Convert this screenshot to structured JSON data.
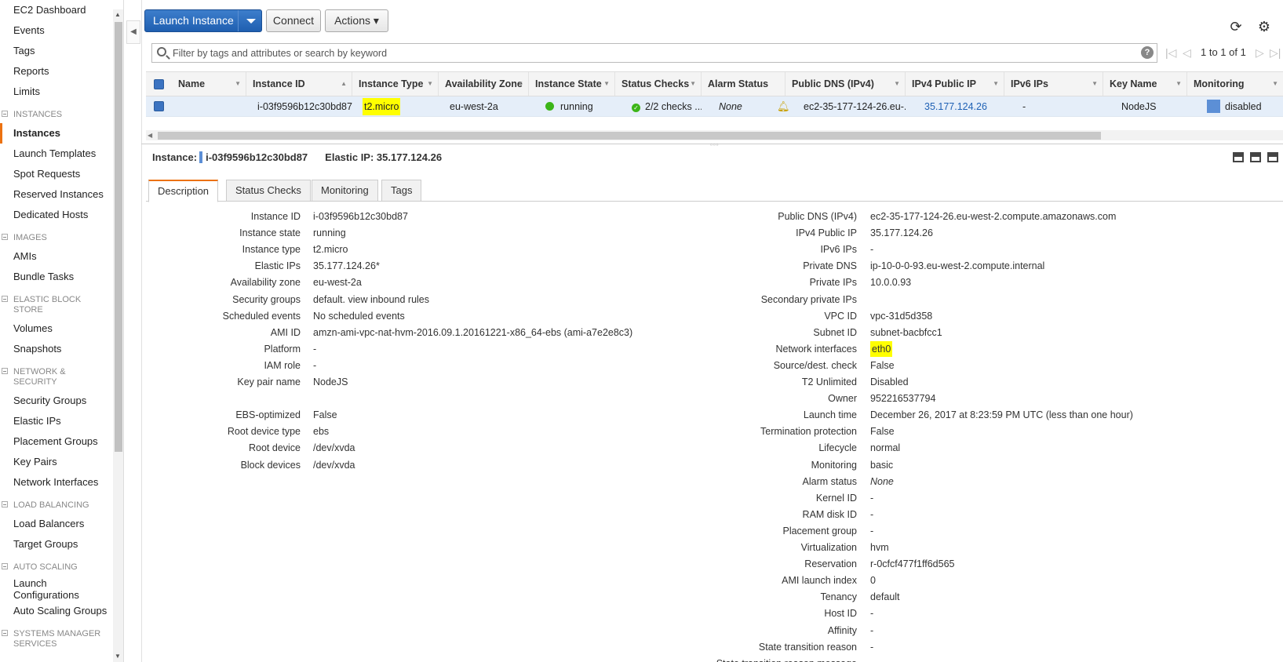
{
  "sidebar": {
    "top_items": [
      "EC2 Dashboard",
      "Events",
      "Tags",
      "Reports",
      "Limits"
    ],
    "sections": [
      {
        "title": "INSTANCES",
        "items": [
          "Instances",
          "Launch Templates",
          "Spot Requests",
          "Reserved Instances",
          "Dedicated Hosts"
        ]
      },
      {
        "title": "IMAGES",
        "items": [
          "AMIs",
          "Bundle Tasks"
        ]
      },
      {
        "title": "ELASTIC BLOCK STORE",
        "items": [
          "Volumes",
          "Snapshots"
        ]
      },
      {
        "title": "NETWORK & SECURITY",
        "items": [
          "Security Groups",
          "Elastic IPs",
          "Placement Groups",
          "Key Pairs",
          "Network Interfaces"
        ]
      },
      {
        "title": "LOAD BALANCING",
        "items": [
          "Load Balancers",
          "Target Groups"
        ]
      },
      {
        "title": "AUTO SCALING",
        "items": [
          "Launch Configurations",
          "Auto Scaling Groups"
        ]
      },
      {
        "title": "SYSTEMS MANAGER SERVICES",
        "items": []
      }
    ],
    "active_item": "Instances"
  },
  "toolbar": {
    "launch_label": "Launch Instance",
    "connect_label": "Connect",
    "actions_label": "Actions ▾",
    "refresh_icon": "refresh-icon",
    "settings_icon": "gear-icon"
  },
  "search": {
    "placeholder": "Filter by tags and attributes or search by keyword",
    "help": "?",
    "pager_text": "1 to 1 of 1"
  },
  "table": {
    "columns": [
      "Name",
      "Instance ID",
      "Instance Type",
      "Availability Zone",
      "Instance State",
      "Status Checks",
      "Alarm Status",
      "Public DNS (IPv4)",
      "IPv4 Public IP",
      "IPv6 IPs",
      "Key Name",
      "Monitoring"
    ],
    "row": {
      "name": "",
      "instance_id": "i-03f9596b12c30bd87",
      "instance_type": "t2.micro",
      "availability_zone": "eu-west-2a",
      "instance_state": "running",
      "status_checks": "2/2 checks ...",
      "alarm_status": "None",
      "public_dns": "ec2-35-177-124-26.eu-...",
      "ipv4_public_ip": "35.177.124.26",
      "ipv6_ips": "-",
      "key_name": "NodeJS",
      "monitoring": "disabled"
    }
  },
  "details": {
    "instance_label": "Instance:",
    "instance_id": "i-03f9596b12c30bd87",
    "elastic_label": "Elastic IP: 35.177.124.26",
    "tabs": [
      "Description",
      "Status Checks",
      "Monitoring",
      "Tags"
    ],
    "left": [
      {
        "key": "Instance ID",
        "value": "i-03f9596b12c30bd87"
      },
      {
        "key": "Instance state",
        "value": "running"
      },
      {
        "key": "Instance type",
        "value": "t2.micro"
      },
      {
        "key": "Elastic IPs",
        "value": "35.177.124.26*",
        "link": true
      },
      {
        "key": "Availability zone",
        "value": "eu-west-2a"
      },
      {
        "key": "Security groups",
        "value": "default. view inbound rules",
        "link": true
      },
      {
        "key": "Scheduled events",
        "value": "No scheduled events",
        "link": true
      },
      {
        "key": "AMI ID",
        "value": "amzn-ami-vpc-nat-hvm-2016.09.1.20161221-x86_64-ebs (ami-a7e2e8c3)",
        "link": true
      },
      {
        "key": "Platform",
        "value": "-"
      },
      {
        "key": "IAM role",
        "value": "-"
      },
      {
        "key": "Key pair name",
        "value": "NodeJS"
      },
      {
        "key": "",
        "value": ""
      },
      {
        "key": "EBS-optimized",
        "value": "False"
      },
      {
        "key": "Root device type",
        "value": "ebs"
      },
      {
        "key": "Root device",
        "value": "/dev/xvda",
        "link": true
      },
      {
        "key": "Block devices",
        "value": "/dev/xvda",
        "link": true
      }
    ],
    "right": [
      {
        "key": "Public DNS (IPv4)",
        "value": "ec2-35-177-124-26.eu-west-2.compute.amazonaws.com"
      },
      {
        "key": "IPv4 Public IP",
        "value": "35.177.124.26",
        "link": true
      },
      {
        "key": "IPv6 IPs",
        "value": "-"
      },
      {
        "key": "Private DNS",
        "value": "ip-10-0-0-93.eu-west-2.compute.internal"
      },
      {
        "key": "Private IPs",
        "value": "10.0.0.93"
      },
      {
        "key": "Secondary private IPs",
        "value": ""
      },
      {
        "key": "VPC ID",
        "value": "vpc-31d5d358"
      },
      {
        "key": "Subnet ID",
        "value": "subnet-bacbfcc1"
      },
      {
        "key": "Network interfaces",
        "value": "eth0",
        "highlight": true
      },
      {
        "key": "Source/dest. check",
        "value": "False"
      },
      {
        "key": "T2 Unlimited",
        "value": "Disabled"
      },
      {
        "key": "Owner",
        "value": "952216537794"
      },
      {
        "key": "Launch time",
        "value": "December 26, 2017 at 8:23:59 PM UTC (less than one hour)"
      },
      {
        "key": "Termination protection",
        "value": "False"
      },
      {
        "key": "Lifecycle",
        "value": "normal"
      },
      {
        "key": "Monitoring",
        "value": "basic"
      },
      {
        "key": "Alarm status",
        "value": "None",
        "italic": true
      },
      {
        "key": "Kernel ID",
        "value": "-"
      },
      {
        "key": "RAM disk ID",
        "value": "-"
      },
      {
        "key": "Placement group",
        "value": "-"
      },
      {
        "key": "Virtualization",
        "value": "hvm"
      },
      {
        "key": "Reservation",
        "value": "r-0cfcf477f1ff6d565"
      },
      {
        "key": "AMI launch index",
        "value": "0"
      },
      {
        "key": "Tenancy",
        "value": "default"
      },
      {
        "key": "Host ID",
        "value": "-"
      },
      {
        "key": "Affinity",
        "value": "-"
      },
      {
        "key": "State transition reason",
        "value": "-"
      },
      {
        "key": "State transition reason message",
        "value": ""
      }
    ]
  },
  "colors": {
    "accent_orange": "#ec7211",
    "primary_blue": "#1f5fb0",
    "link_blue": "#1f61b5",
    "highlight_yellow": "#ffff00",
    "running_green": "#3cb518"
  }
}
